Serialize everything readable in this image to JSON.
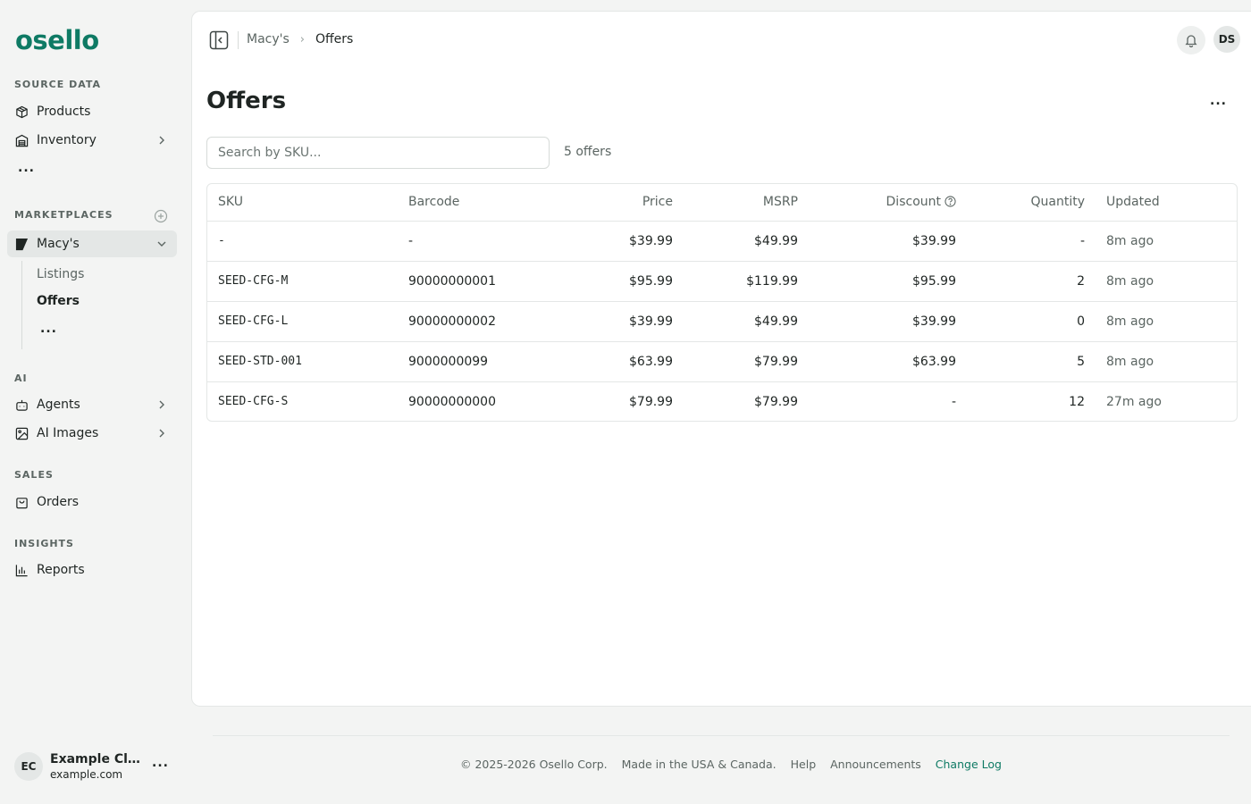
{
  "brand": {
    "logo_text": "osello",
    "accent_color": "#0e7a64"
  },
  "sidebar": {
    "sections": {
      "source_data": "SOURCE DATA",
      "marketplaces": "MARKETPLACES",
      "ai": "AI",
      "sales": "SALES",
      "insights": "INSIGHTS"
    },
    "items": {
      "products": "Products",
      "inventory": "Inventory",
      "source_more": "...",
      "macys": "Macy's",
      "listings": "Listings",
      "offers": "Offers",
      "macys_more": "...",
      "agents": "Agents",
      "ai_images": "AI Images",
      "orders": "Orders",
      "reports": "Reports"
    },
    "user": {
      "initials": "EC",
      "name": "Example Client",
      "domain": "example.com",
      "more": "..."
    }
  },
  "header": {
    "breadcrumb": [
      "Macy's",
      "Offers"
    ],
    "avatar_initials": "DS"
  },
  "page": {
    "title": "Offers",
    "more": "...",
    "search_placeholder": "Search by SKU...",
    "count_label": "5 offers"
  },
  "table": {
    "headers": [
      "SKU",
      "Barcode",
      "Price",
      "MSRP",
      "Discount",
      "Quantity",
      "Updated"
    ],
    "rows": [
      {
        "sku": "-",
        "barcode": "-",
        "price": "$39.99",
        "msrp": "$49.99",
        "discount": "$39.99",
        "quantity": "-",
        "updated": "8m ago"
      },
      {
        "sku": "SEED-CFG-M",
        "barcode": "90000000001",
        "price": "$95.99",
        "msrp": "$119.99",
        "discount": "$95.99",
        "quantity": "2",
        "updated": "8m ago"
      },
      {
        "sku": "SEED-CFG-L",
        "barcode": "90000000002",
        "price": "$39.99",
        "msrp": "$49.99",
        "discount": "$39.99",
        "quantity": "0",
        "updated": "8m ago"
      },
      {
        "sku": "SEED-STD-001",
        "barcode": "9000000099",
        "price": "$63.99",
        "msrp": "$79.99",
        "discount": "$63.99",
        "quantity": "5",
        "updated": "8m ago"
      },
      {
        "sku": "SEED-CFG-S",
        "barcode": "90000000000",
        "price": "$79.99",
        "msrp": "$79.99",
        "discount": "-",
        "quantity": "12",
        "updated": "27m ago"
      }
    ]
  },
  "footer": {
    "copyright": "© 2025-2026 Osello Corp.",
    "made_in": "Made in the USA & Canada.",
    "help": "Help",
    "announcements": "Announcements",
    "changelog": "Change Log"
  }
}
